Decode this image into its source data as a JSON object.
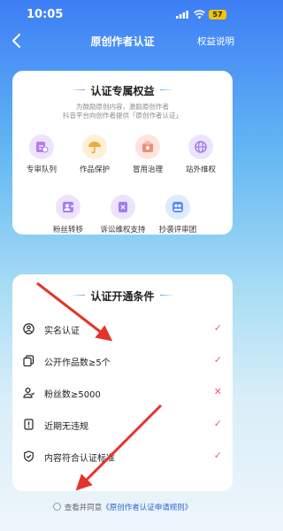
{
  "status": {
    "time": "10:05",
    "battery": "57"
  },
  "nav": {
    "title": "原创作者认证",
    "right_label": "权益说明"
  },
  "benefits": {
    "title": "认证专属权益",
    "desc_line1": "为鼓励原创内容，激励原创作者",
    "desc_line2": "抖音平台向创作者提供「原创作者认证」",
    "items": [
      {
        "label": "专审队列",
        "icon": "review-queue-icon",
        "color": "#b07ef0"
      },
      {
        "label": "作品保护",
        "icon": "umbrella-icon",
        "color": "#f2a93b"
      },
      {
        "label": "冒用治理",
        "icon": "governance-icon",
        "color": "#f28c7a"
      },
      {
        "label": "站外维权",
        "icon": "globe-icon",
        "color": "#9d7bf2"
      },
      {
        "label": "粉丝转移",
        "icon": "fan-transfer-icon",
        "color": "#a67ef4"
      },
      {
        "label": "诉讼维权支持",
        "icon": "litigation-icon",
        "color": "#9e7ef3"
      },
      {
        "label": "抄袭评审团",
        "icon": "jury-icon",
        "color": "#5b8ff2"
      }
    ]
  },
  "conditions": {
    "title": "认证开通条件",
    "items": [
      {
        "label": "实名认证",
        "icon": "user-circle-icon",
        "status": "✓",
        "met": true
      },
      {
        "label": "公开作品数≥5个",
        "icon": "works-copy-icon",
        "status": "✓",
        "met": true
      },
      {
        "label": "粉丝数≥5000",
        "icon": "fans-icon",
        "status": "✕",
        "met": false
      },
      {
        "label": "近期无违规",
        "icon": "no-violation-icon",
        "status": "✓",
        "met": true
      },
      {
        "label": "内容符合认证标准",
        "icon": "shield-check-icon",
        "status": "✓",
        "met": true
      }
    ]
  },
  "agreement": {
    "prefix": "查看并同意",
    "link": "《原创作者认证申请规则》"
  },
  "colors": {
    "check": "#f25a6e",
    "link": "#2f5fd6",
    "arrow": "#e5342c"
  }
}
